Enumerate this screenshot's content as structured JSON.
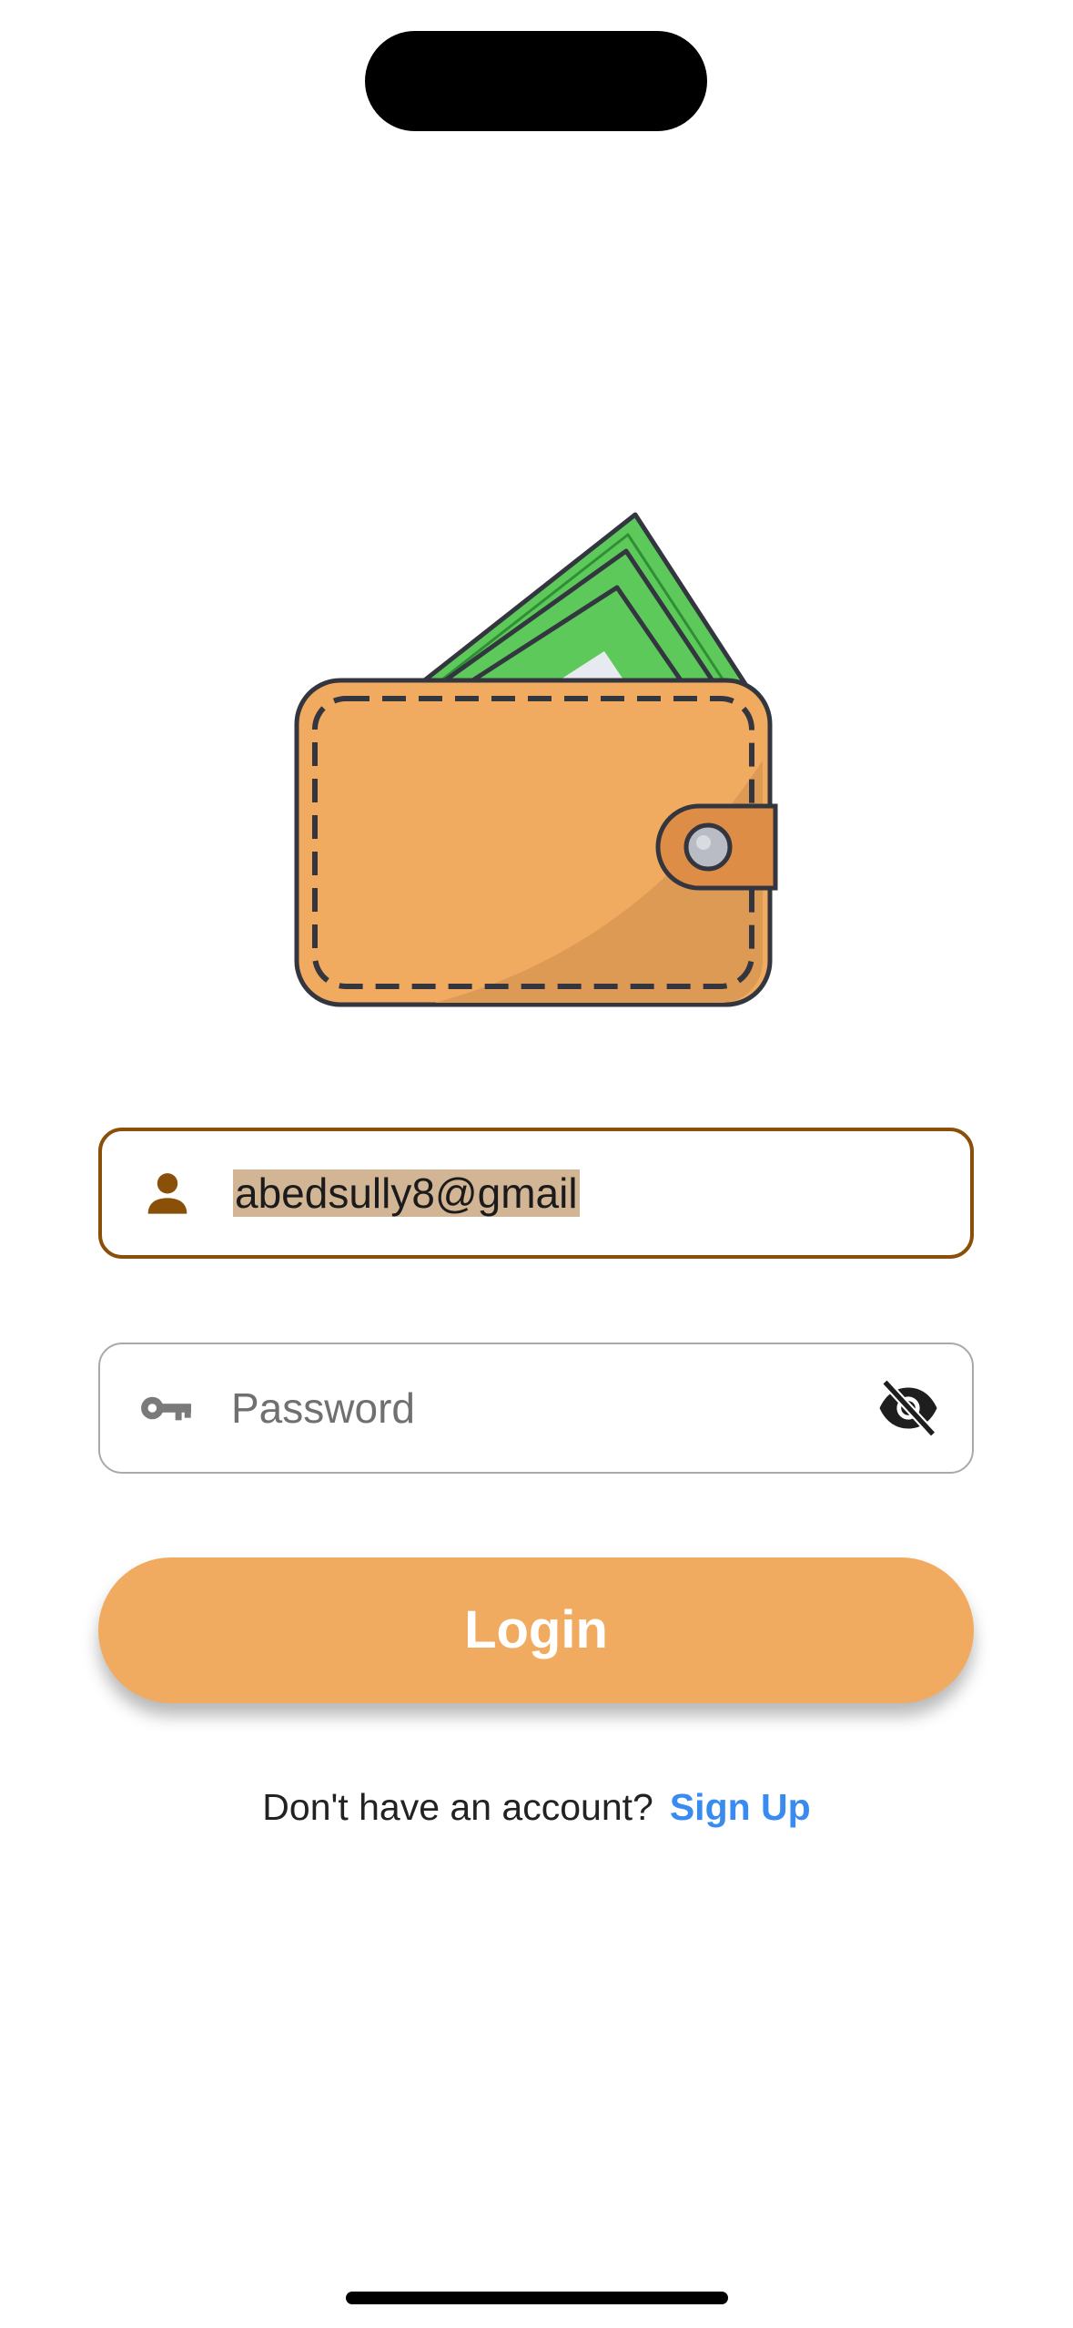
{
  "login_form": {
    "email_value": "abedsully8@gmail",
    "password_placeholder": "Password",
    "login_label": "Login"
  },
  "signup_prompt": {
    "text": "Don't have an account?",
    "link_label": "Sign Up"
  },
  "icons": {
    "app_logo": "wallet-with-cash-icon",
    "email_field": "person-icon",
    "password_field": "key-icon",
    "password_toggle": "eye-off-icon"
  },
  "colors": {
    "accent_orange": "#f1ab60",
    "focused_border": "#8a4f08",
    "link_blue": "#3a8bf0",
    "email_selection": "#d2b594"
  }
}
